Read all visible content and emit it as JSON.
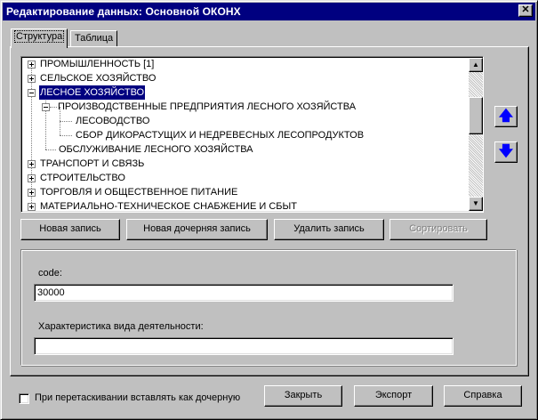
{
  "window": {
    "title": "Редактирование данных: Основной ОКОНХ",
    "close_glyph": "✕"
  },
  "tabs": [
    {
      "label": "Структура",
      "active": true
    },
    {
      "label": "Таблица",
      "active": false
    }
  ],
  "tree": {
    "items": [
      {
        "label": "ПРОМЫШЛЕННОСТЬ [1]",
        "expander": "plus",
        "selected": false
      },
      {
        "label": "СЕЛЬСКОЕ ХОЗЯЙСТВО",
        "expander": "plus",
        "selected": false
      },
      {
        "label": "ЛЕСНОЕ ХОЗЯЙСТВО",
        "expander": "minus",
        "selected": true
      },
      {
        "label": "ПРОИЗВОДСТВЕННЫЕ ПРЕДПРИЯТИЯ ЛЕСНОГО ХОЗЯЙСТВА",
        "expander": "minus",
        "selected": false
      },
      {
        "label": "ЛЕСОВОДСТВО",
        "expander": "none",
        "selected": false
      },
      {
        "label": "СБОР ДИКОРАСТУЩИХ И НЕДРЕВЕСНЫХ ЛЕСОПРОДУКТОВ",
        "expander": "none",
        "selected": false
      },
      {
        "label": "ОБСЛУЖИВАНИЕ ЛЕСНОГО ХОЗЯЙСТВА",
        "expander": "none",
        "selected": false
      },
      {
        "label": "ТРАНСПОРТ И СВЯЗЬ",
        "expander": "plus",
        "selected": false
      },
      {
        "label": "СТРОИТЕЛЬСТВО",
        "expander": "plus",
        "selected": false
      },
      {
        "label": "ТОРГОВЛЯ И ОБЩЕСТВЕННОЕ ПИТАНИЕ",
        "expander": "plus",
        "selected": false
      },
      {
        "label": "МАТЕРИАЛЬНО-ТЕХНИЧЕСКОЕ СНАБЖЕНИЕ И СБЫТ",
        "expander": "plus",
        "selected": false
      }
    ],
    "scroll_up_glyph": "▲",
    "scroll_down_glyph": "▼"
  },
  "side_buttons": {
    "move_up_glyph": "🡅",
    "move_down_glyph": "🡇",
    "color": "#0000ff"
  },
  "actions": {
    "new_record": "Новая запись",
    "new_child_record": "Новая дочерняя запись",
    "delete_record": "Удалить запись",
    "sort": "Сортировать"
  },
  "form": {
    "code_label": "code:",
    "code_value": "30000",
    "description_label": "Характеристика вида деятельности:",
    "description_value": ""
  },
  "footer": {
    "checkbox_label": "При перетаскивании вставлять как дочерную",
    "checkbox_checked": false,
    "close": "Закрыть",
    "export": "Экспорт",
    "help": "Справка"
  },
  "colors": {
    "titlebar": "#000080",
    "window_bg": "#c0c0c0",
    "selection": "#000080"
  }
}
